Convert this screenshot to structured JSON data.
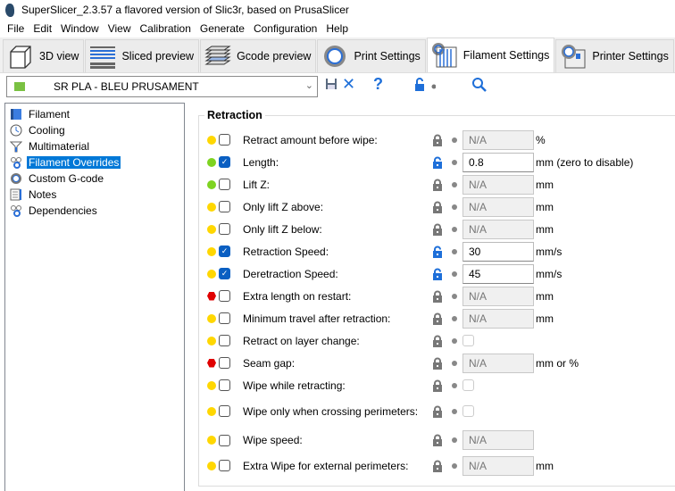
{
  "window": {
    "title": "SuperSlicer_2.3.57 a flavored version of Slic3r, based on PrusaSlicer"
  },
  "menu": [
    "File",
    "Edit",
    "Window",
    "View",
    "Calibration",
    "Generate",
    "Configuration",
    "Help"
  ],
  "tabs": [
    {
      "label": "3D view",
      "icon": "cube-icon"
    },
    {
      "label": "Sliced preview",
      "icon": "layers-icon"
    },
    {
      "label": "Gcode preview",
      "icon": "stack-icon"
    },
    {
      "label": "Print Settings",
      "icon": "gear-icon"
    },
    {
      "label": "Filament Settings",
      "icon": "spool-icon",
      "active": true
    },
    {
      "label": "Printer Settings",
      "icon": "printer-icon"
    }
  ],
  "preset": {
    "value": "SR PLA - BLEU PRUSAMENT",
    "color": "#7ac142"
  },
  "toolbar": {
    "help": "?"
  },
  "tree": [
    {
      "label": "Filament",
      "icon": "filament-icon"
    },
    {
      "label": "Cooling",
      "icon": "clock-icon"
    },
    {
      "label": "Multimaterial",
      "icon": "funnel-icon"
    },
    {
      "label": "Filament Overrides",
      "icon": "wrench-icon",
      "selected": true
    },
    {
      "label": "Custom G-code",
      "icon": "gear-icon"
    },
    {
      "label": "Notes",
      "icon": "notes-icon"
    },
    {
      "label": "Dependencies",
      "icon": "wrench-icon"
    }
  ],
  "section": {
    "title": "Retraction"
  },
  "colors": {
    "yellow": "#ffd700",
    "green": "#7ed321",
    "red": "#e00000",
    "accent": "#0a5fc2"
  },
  "rows": [
    {
      "label": "Retract amount before wipe:",
      "mark": "yellow",
      "checked": false,
      "locked": true,
      "type": "text",
      "value": "N/A",
      "unit": "%"
    },
    {
      "label": "Length:",
      "mark": "green",
      "checked": true,
      "locked": false,
      "type": "text",
      "value": "0.8",
      "unit": "mm (zero to disable)"
    },
    {
      "label": "Lift Z:",
      "mark": "green",
      "checked": false,
      "locked": true,
      "type": "text",
      "value": "N/A",
      "unit": "mm"
    },
    {
      "label": "Only lift Z above:",
      "mark": "yellow",
      "checked": false,
      "locked": true,
      "type": "text",
      "value": "N/A",
      "unit": "mm"
    },
    {
      "label": "Only lift Z below:",
      "mark": "yellow",
      "checked": false,
      "locked": true,
      "type": "text",
      "value": "N/A",
      "unit": "mm"
    },
    {
      "label": "Retraction Speed:",
      "mark": "yellow",
      "checked": true,
      "locked": false,
      "type": "text",
      "value": "30",
      "unit": "mm/s"
    },
    {
      "label": "Deretraction Speed:",
      "mark": "yellow",
      "checked": true,
      "locked": false,
      "type": "text",
      "value": "45",
      "unit": "mm/s"
    },
    {
      "label": "Extra length on restart:",
      "mark": "red",
      "checked": false,
      "locked": true,
      "type": "text",
      "value": "N/A",
      "unit": "mm"
    },
    {
      "label": "Minimum travel after retraction:",
      "mark": "yellow",
      "checked": false,
      "locked": true,
      "type": "text",
      "value": "N/A",
      "unit": "mm"
    },
    {
      "label": "Retract on layer change:",
      "mark": "yellow",
      "checked": false,
      "locked": true,
      "type": "checkbox"
    },
    {
      "label": "Seam gap:",
      "mark": "red",
      "checked": false,
      "locked": true,
      "type": "text",
      "value": "N/A",
      "unit": "mm or %"
    },
    {
      "label": "Wipe while retracting:",
      "mark": "yellow",
      "checked": false,
      "locked": true,
      "type": "checkbox"
    },
    {
      "label": "Wipe only when crossing perimeters:",
      "mark": "yellow",
      "checked": false,
      "locked": true,
      "type": "checkbox"
    },
    {
      "label": "Wipe speed:",
      "mark": "yellow",
      "checked": false,
      "locked": true,
      "type": "text",
      "value": "N/A",
      "unit": ""
    },
    {
      "label": "Extra Wipe for external perimeters:",
      "mark": "yellow",
      "checked": false,
      "locked": true,
      "type": "text",
      "value": "N/A",
      "unit": "mm"
    }
  ]
}
